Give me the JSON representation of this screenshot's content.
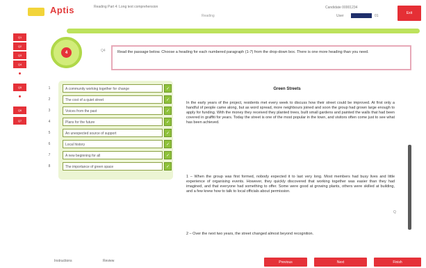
{
  "header": {
    "logo_text": "Aptis",
    "title": "Reading Part 4: Long text comprehension",
    "subtitle": "Reading",
    "meta": "Candidate  00001234",
    "user_label": "User",
    "user_number": "01",
    "exit_label": "Exit"
  },
  "sidebar": {
    "items": [
      {
        "label": "Q1"
      },
      {
        "label": "Q2"
      },
      {
        "label": "Q3"
      },
      {
        "label": "Q4"
      },
      {
        "label": "Q5"
      },
      {
        "label": "Q6"
      },
      {
        "label": "Q7"
      }
    ]
  },
  "question": {
    "number": "4",
    "label": "Q4",
    "prompt": "Read the passage below. Choose a heading for each numbered paragraph (1-7) from the drop-down box. There is one more heading than you need."
  },
  "answers": [
    {
      "num": "1",
      "value": "A community working together for change",
      "icon": "check-icon"
    },
    {
      "num": "2",
      "value": "The cost of a quiet street",
      "icon": "check-icon"
    },
    {
      "num": "3",
      "value": "Voices from the past",
      "icon": "check-icon"
    },
    {
      "num": "4",
      "value": "Plans for the future",
      "icon": "check-icon"
    },
    {
      "num": "5",
      "value": "An unexpected source of support",
      "icon": "check-icon"
    },
    {
      "num": "6",
      "value": "Local history",
      "icon": "check-icon"
    },
    {
      "num": "7",
      "value": "A new beginning for all",
      "icon": "check-icon"
    },
    {
      "num": "8",
      "value": "The importance of green space",
      "icon": "check-icon"
    }
  ],
  "passage": {
    "title": "Green Streets",
    "paragraphs": [
      "In the early years of the project, residents met every week to discuss how their street could be improved. At first only a handful of people came along, but as word spread, more neighbours joined and soon the group had grown large enough to apply for funding. With the money they received they planted trees, built small gardens and painted the walls that had been covered in graffiti for years. Today the street is one of the most popular in the town, and visitors often come just to see what has been achieved.",
      "1 – When the group was first formed, nobody expected it to last very long. Most members had busy lives and little experience of organising events. However, they quickly discovered that working together was easier than they had imagined, and that everyone had something to offer. Some were good at growing plants, others were skilled at building, and a few knew how to talk to local officials about permission.",
      "2 – Over the next two years, the street changed almost beyond recognition."
    ],
    "mark": "Q"
  },
  "footer": {
    "left_links": [
      "Instructions",
      "Review"
    ],
    "buttons": [
      "Previous",
      "Next",
      "Finish"
    ]
  }
}
